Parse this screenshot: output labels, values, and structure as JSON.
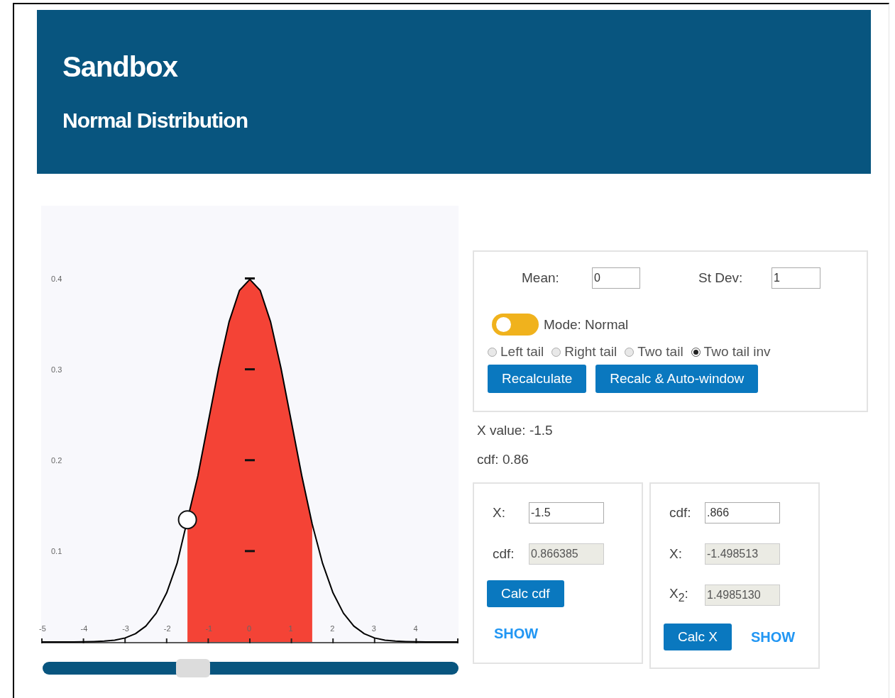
{
  "header": {
    "title": "Sandbox",
    "subtitle": "Normal Distribution"
  },
  "chart": {
    "chart_data": {
      "type": "line",
      "x": [
        -5,
        -4.75,
        -4.5,
        -4.25,
        -4,
        -3.75,
        -3.5,
        -3.25,
        -3,
        -2.75,
        -2.5,
        -2.25,
        -2,
        -1.75,
        -1.5,
        -1.25,
        -1,
        -0.75,
        -0.5,
        -0.25,
        0,
        0.25,
        0.5,
        0.75,
        1,
        1.25,
        1.5,
        1.75,
        2,
        2.25,
        2.5,
        2.75,
        3,
        3.25,
        3.5,
        3.75,
        4,
        4.25,
        4.5,
        4.75,
        5
      ],
      "series": [
        {
          "color": "#000000",
          "values": [
            0,
            0,
            0,
            0,
            0.0001,
            0.0004,
            0.0009,
            0.002,
            0.0044,
            0.0091,
            0.0175,
            0.0317,
            0.054,
            0.0863,
            null,
            0.1826,
            0.242,
            0.3011,
            0.3521,
            0.3867,
            0.3989,
            0.3867,
            0.3521,
            0.3011,
            0.242,
            0.1826,
            0.1295,
            0.0863,
            0.054,
            0.0317,
            0.0175,
            0.0091,
            0.0044,
            0.002,
            0.0009,
            0.0004,
            0.0001,
            0,
            0,
            0,
            0
          ]
        }
      ],
      "xlim": [
        -5,
        5
      ],
      "ylim": [
        0,
        0.48
      ],
      "xticks": [
        -5,
        -4,
        -3,
        -2,
        -1,
        0,
        1,
        2,
        3,
        4
      ],
      "yticks": [
        0.1,
        0.2,
        0.3,
        0.4
      ]
    }
  },
  "slider": {
    "level": 0.35
  },
  "parameters": {
    "fields": [
      {
        "label": "Mean:",
        "value": "0"
      },
      {
        "label": "St Dev:",
        "value": "1"
      }
    ],
    "mode_toggle": {
      "label": "Mode: Normal",
      "on": false
    },
    "tail_options": [
      {
        "label": "Left tail",
        "selected": false
      },
      {
        "label": "Right tail",
        "selected": false
      },
      {
        "label": "Two tail",
        "selected": false
      },
      {
        "label": "Two tail inv",
        "selected": true
      }
    ],
    "buttons": [
      "Recalculate",
      "Recalc & Auto-window"
    ]
  },
  "results": [
    "X value: -1.5",
    "cdf: 0.86"
  ],
  "cdf_calculator": {
    "fields": [
      {
        "label": "X:",
        "value": "-1.5",
        "disabled": false
      },
      {
        "label": "cdf:",
        "value": "0.866385",
        "disabled": true
      }
    ],
    "button": "Calc cdf",
    "link": "SHOW"
  },
  "inverse_calculator": {
    "fields": [
      {
        "label": "cdf:",
        "value": ".866",
        "disabled": false
      },
      {
        "label": "X:",
        "value": "-1.498513",
        "disabled": true
      },
      {
        "label": "X$_{2}$:",
        "value": "1.4985130",
        "disabled": true
      }
    ],
    "button": "Calc X",
    "link": "SHOW"
  }
}
